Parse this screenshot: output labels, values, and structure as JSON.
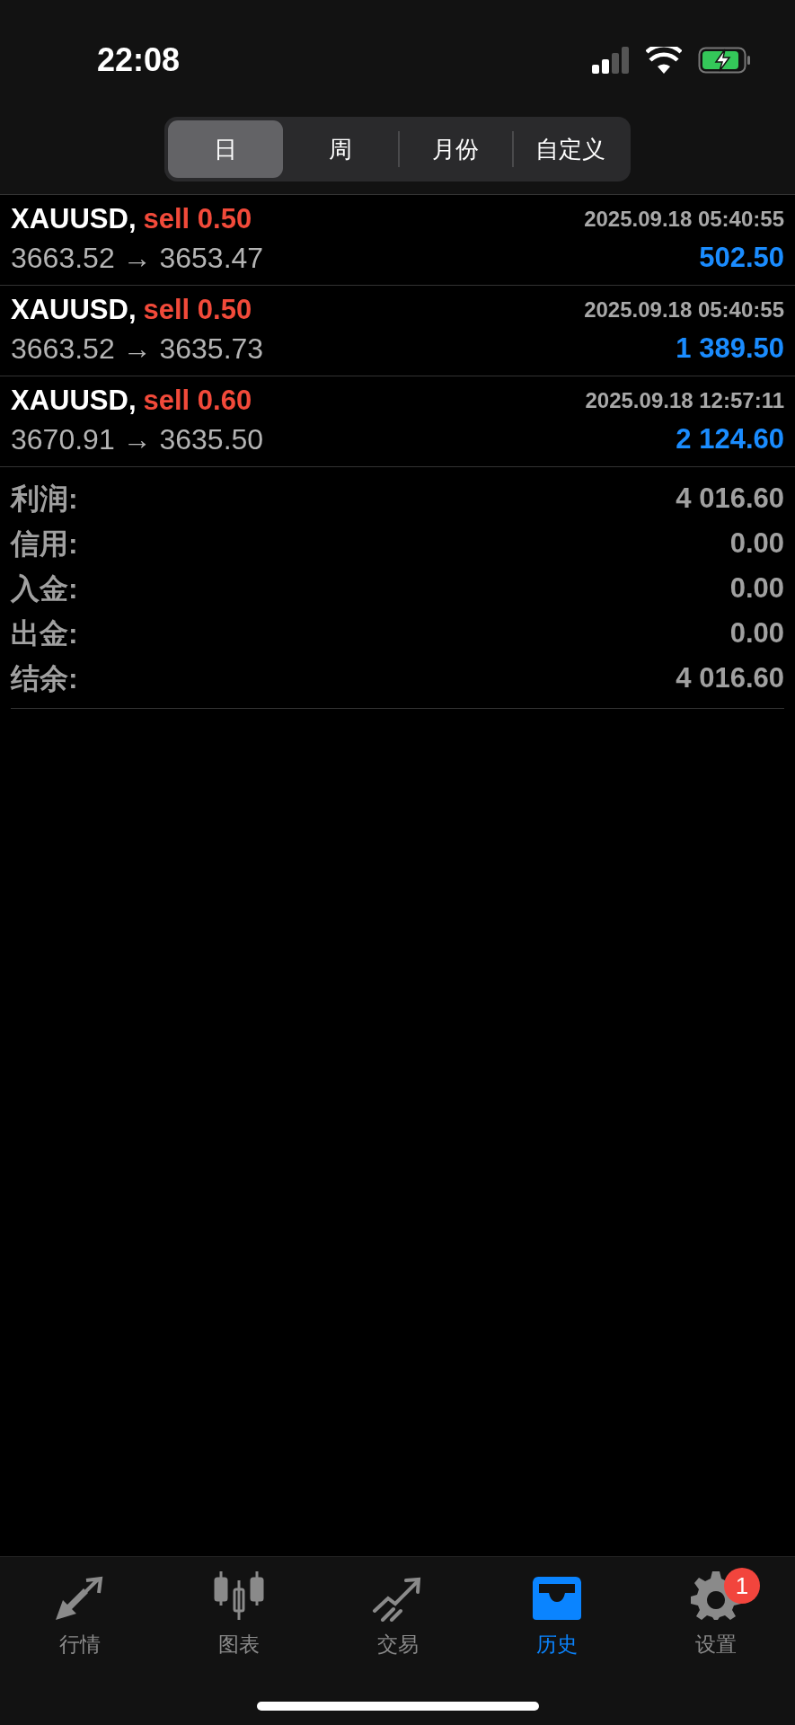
{
  "status_bar": {
    "time": "22:08"
  },
  "segments": [
    {
      "label": "日",
      "selected": true
    },
    {
      "label": "周",
      "selected": false
    },
    {
      "label": "月份",
      "selected": false
    },
    {
      "label": "自定义",
      "selected": false
    }
  ],
  "deals": [
    {
      "symbol": "XAUUSD,",
      "side": "sell 0.50",
      "time": "2025.09.18 05:40:55",
      "prices": "3663.52 → 3653.47",
      "profit": "502.50"
    },
    {
      "symbol": "XAUUSD,",
      "side": "sell 0.50",
      "time": "2025.09.18 05:40:55",
      "prices": "3663.52 → 3635.73",
      "profit": "1 389.50"
    },
    {
      "symbol": "XAUUSD,",
      "side": "sell 0.60",
      "time": "2025.09.18 12:57:11",
      "prices": "3670.91 → 3635.50",
      "profit": "2 124.60"
    }
  ],
  "summary": [
    {
      "label": "利润:",
      "value": "4 016.60"
    },
    {
      "label": "信用:",
      "value": "0.00"
    },
    {
      "label": "入金:",
      "value": "0.00"
    },
    {
      "label": "出金:",
      "value": "0.00"
    },
    {
      "label": "结余:",
      "value": "4 016.60"
    }
  ],
  "tab_bar": [
    {
      "kind": "quotes",
      "label": "行情",
      "selected": false
    },
    {
      "kind": "chart",
      "label": "图表",
      "selected": false
    },
    {
      "kind": "trade",
      "label": "交易",
      "selected": false
    },
    {
      "kind": "history",
      "label": "历史",
      "selected": true
    },
    {
      "kind": "settings",
      "label": "设置",
      "selected": false,
      "badge": "1"
    }
  ]
}
